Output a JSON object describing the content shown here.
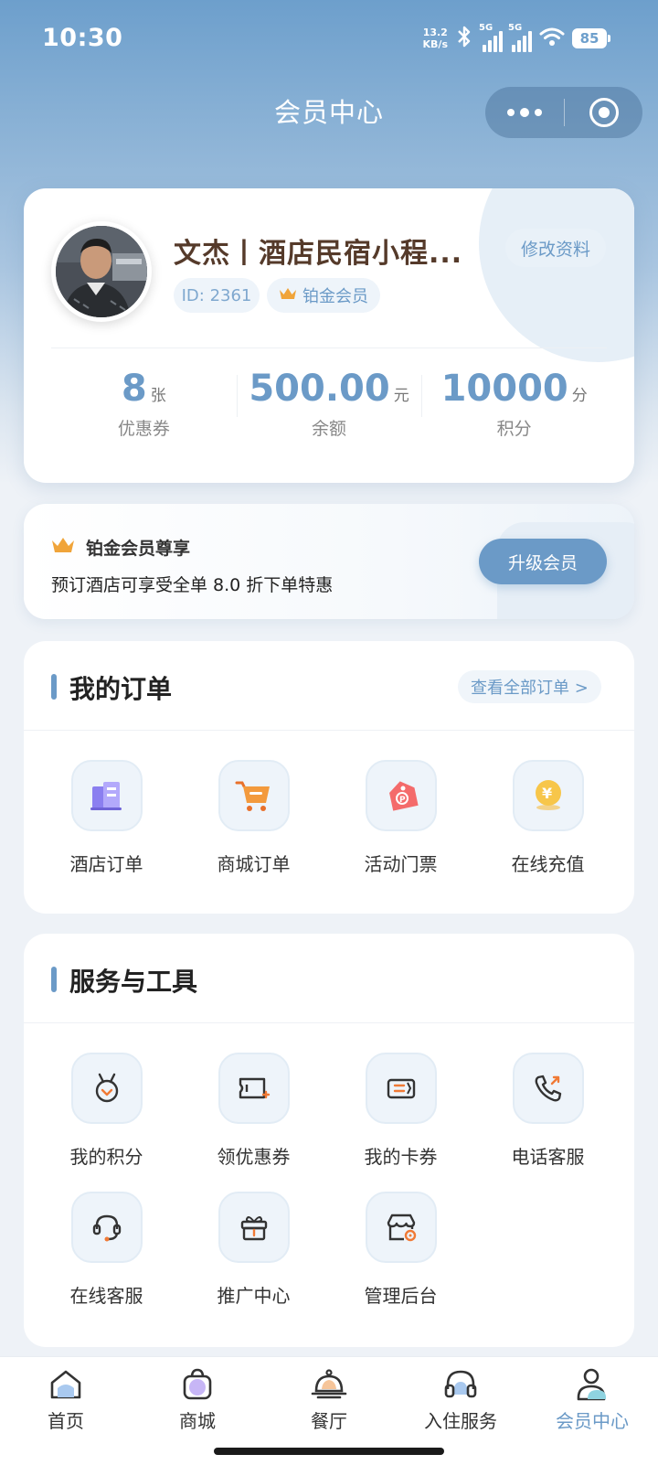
{
  "status_bar": {
    "time": "10:30",
    "net_speed_value": "13.2",
    "net_speed_unit": "KB/s",
    "signal_tag": "5G",
    "signal_tag_2": "5G",
    "battery": "85",
    "icons": [
      "bluetooth-icon",
      "signal-icon",
      "signal-icon",
      "wifi-icon",
      "battery-icon"
    ]
  },
  "nav": {
    "title": "会员中心",
    "capsule_icons": [
      "more-icon",
      "close-target-icon"
    ]
  },
  "profile": {
    "name": "文杰丨酒店民宿小程...",
    "edit_label": "修改资料",
    "id_label": "ID: 2361",
    "level_label": "铂金会员",
    "stats": [
      {
        "value": "8",
        "unit": "张",
        "label": "优惠券"
      },
      {
        "value": "500.00",
        "unit": "元",
        "label": "余额"
      },
      {
        "value": "10000",
        "unit": "分",
        "label": "积分"
      }
    ]
  },
  "vip": {
    "title": "铂金会员尊享",
    "description": "预订酒店可享受全单 8.0 折下单特惠",
    "upgrade_label": "升级会员"
  },
  "orders": {
    "title": "我的订单",
    "view_all": "查看全部订单 >",
    "items": [
      {
        "label": "酒店订单",
        "icon": "hotel-icon"
      },
      {
        "label": "商城订单",
        "icon": "cart-icon"
      },
      {
        "label": "活动门票",
        "icon": "ticket-tag-icon"
      },
      {
        "label": "在线充值",
        "icon": "yuan-coin-icon"
      }
    ]
  },
  "services": {
    "title": "服务与工具",
    "items": [
      {
        "label": "我的积分",
        "icon": "medal-icon"
      },
      {
        "label": "领优惠券",
        "icon": "coupon-add-icon"
      },
      {
        "label": "我的卡券",
        "icon": "card-icon"
      },
      {
        "label": "电话客服",
        "icon": "phone-icon"
      },
      {
        "label": "在线客服",
        "icon": "headset-icon"
      },
      {
        "label": "推广中心",
        "icon": "gift-icon"
      },
      {
        "label": "管理后台",
        "icon": "store-settings-icon"
      }
    ]
  },
  "tab_bar": {
    "items": [
      {
        "label": "首页",
        "icon": "home-icon"
      },
      {
        "label": "商城",
        "icon": "shopping-bag-icon"
      },
      {
        "label": "餐厅",
        "icon": "food-cloche-icon"
      },
      {
        "label": "入住服务",
        "icon": "headphones-icon"
      },
      {
        "label": "会员中心",
        "icon": "user-icon"
      }
    ],
    "active": "会员中心"
  },
  "colors": {
    "accent": "#6b9ac7",
    "header_top": "#6d9fcc",
    "name_brown": "#553a2a",
    "crown_gold": "#f0a43a"
  }
}
